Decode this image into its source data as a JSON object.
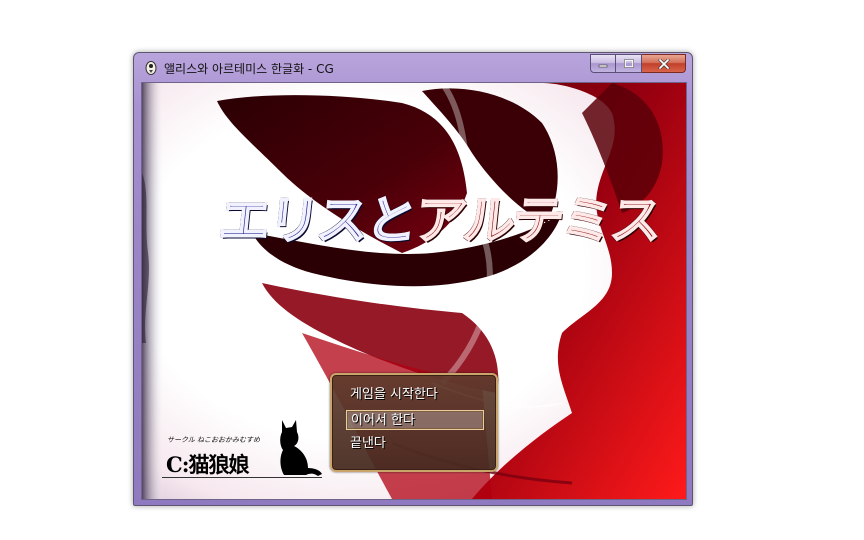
{
  "window": {
    "title": "앨리스와 아르테미스 한글화 - CG",
    "frame_color": "#9c86c8",
    "close_color": "#c2402a"
  },
  "game": {
    "title_blue": "エリスと",
    "title_red": "アルテミス",
    "title_blue_color": "#2e2f9a",
    "title_red_color": "#8a1010",
    "background_color": "#c00000"
  },
  "menu": {
    "items": [
      {
        "label": "게임을 시작한다",
        "selected": false
      },
      {
        "label": "이어서 한다",
        "selected": true
      },
      {
        "label": "끝낸다",
        "selected": false
      }
    ]
  },
  "logo": {
    "small_text": "サークル ねこおおかみむすめ",
    "big_text": "C:猫狼娘",
    "icon": "cat-silhouette-icon"
  }
}
